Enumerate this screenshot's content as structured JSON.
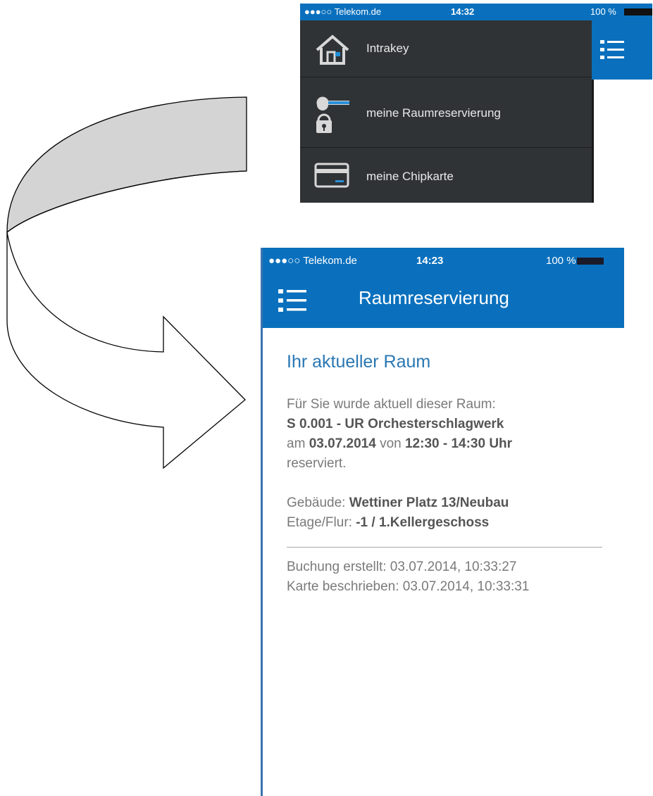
{
  "menu_screenshot": {
    "status": {
      "carrier": "●●●○○ Telekom.de",
      "time": "14:32",
      "battery": "100 %"
    },
    "items": [
      {
        "label": "Intrakey",
        "icon": "home-icon"
      },
      {
        "label": "meine Raumreservierung",
        "icon": "key-lock-icon"
      },
      {
        "label": "meine Chipkarte",
        "icon": "card-icon"
      }
    ]
  },
  "reservation_screenshot": {
    "status": {
      "carrier": "●●●○○ Telekom.de",
      "time": "14:23",
      "battery": "100 %"
    },
    "title": "Raumreservierung",
    "heading": "Ihr aktueller Raum",
    "intro": "Für Sie wurde aktuell dieser Raum:",
    "room": "S 0.001 - UR Orchesterschlagwerk",
    "date_prefix": "am",
    "date": "03.07.2014",
    "time_prefix": "von",
    "time": "12:30 - 14:30 Uhr",
    "reserved": "reserviert.",
    "building_label": "Gebäude:",
    "building": "Wettiner Platz 13/Neubau",
    "floor_label": "Etage/Flur:",
    "floor": "-1 / 1.Kellergeschoss",
    "booking_created": "Buchung erstellt: 03.07.2014, 10:33:27",
    "card_written": "Karte beschrieben: 03.07.2014, 10:33:31"
  },
  "colors": {
    "accent": "#0a70bd",
    "drawer": "#303336",
    "heading": "#2a77b3",
    "text": "#7a7a7a"
  }
}
